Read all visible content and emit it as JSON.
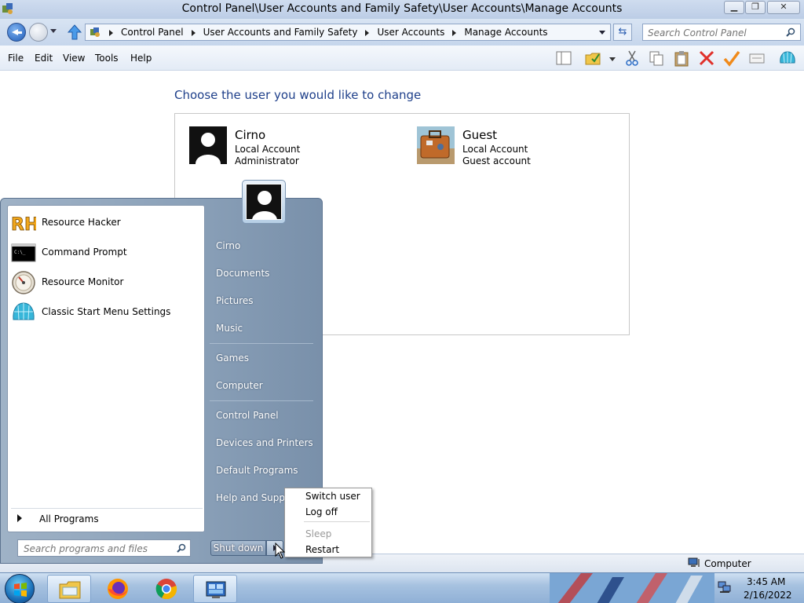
{
  "window": {
    "title": "Control Panel\\User Accounts and Family Safety\\User Accounts\\Manage Accounts",
    "address_crumbs": [
      "Control Panel",
      "User Accounts and Family Safety",
      "User Accounts",
      "Manage Accounts"
    ],
    "search_placeholder": "Search Control Panel"
  },
  "menubar": {
    "items": [
      "File",
      "Edit",
      "View",
      "Tools",
      "Help"
    ]
  },
  "content": {
    "heading": "Choose the user you would like to change",
    "accounts": [
      {
        "name": "Cirno",
        "type": "Local Account",
        "role": "Administrator",
        "icon": "user-silhouette-icon"
      },
      {
        "name": "Guest",
        "type": "Local Account",
        "role": "Guest account",
        "icon": "briefcase-icon"
      }
    ]
  },
  "statusbar": {
    "location": "Computer"
  },
  "start_menu": {
    "programs": [
      {
        "label": "Resource Hacker",
        "icon": "resource-hacker-icon"
      },
      {
        "label": "Command Prompt",
        "icon": "command-prompt-icon"
      },
      {
        "label": "Resource Monitor",
        "icon": "resource-monitor-icon"
      },
      {
        "label": "Classic Start Menu Settings",
        "icon": "shell-icon"
      }
    ],
    "all_programs": "All Programs",
    "search_placeholder": "Search programs and files",
    "right_items": [
      "Cirno",
      "Documents",
      "Pictures",
      "Music",
      "Games",
      "Computer",
      "Control Panel",
      "Devices and Printers",
      "Default Programs",
      "Help and Support"
    ],
    "shutdown_label": "Shut down"
  },
  "power_menu": {
    "items": [
      {
        "label": "Switch user",
        "enabled": true
      },
      {
        "label": "Log off",
        "enabled": true
      },
      {
        "label": "Sleep",
        "enabled": false
      },
      {
        "label": "Restart",
        "enabled": true
      }
    ]
  },
  "taskbar": {
    "pinned": [
      "windows-explorer-icon",
      "firefox-icon",
      "chrome-icon",
      "control-panel-icon"
    ],
    "time": "3:45 AM",
    "date": "2/16/2022"
  }
}
